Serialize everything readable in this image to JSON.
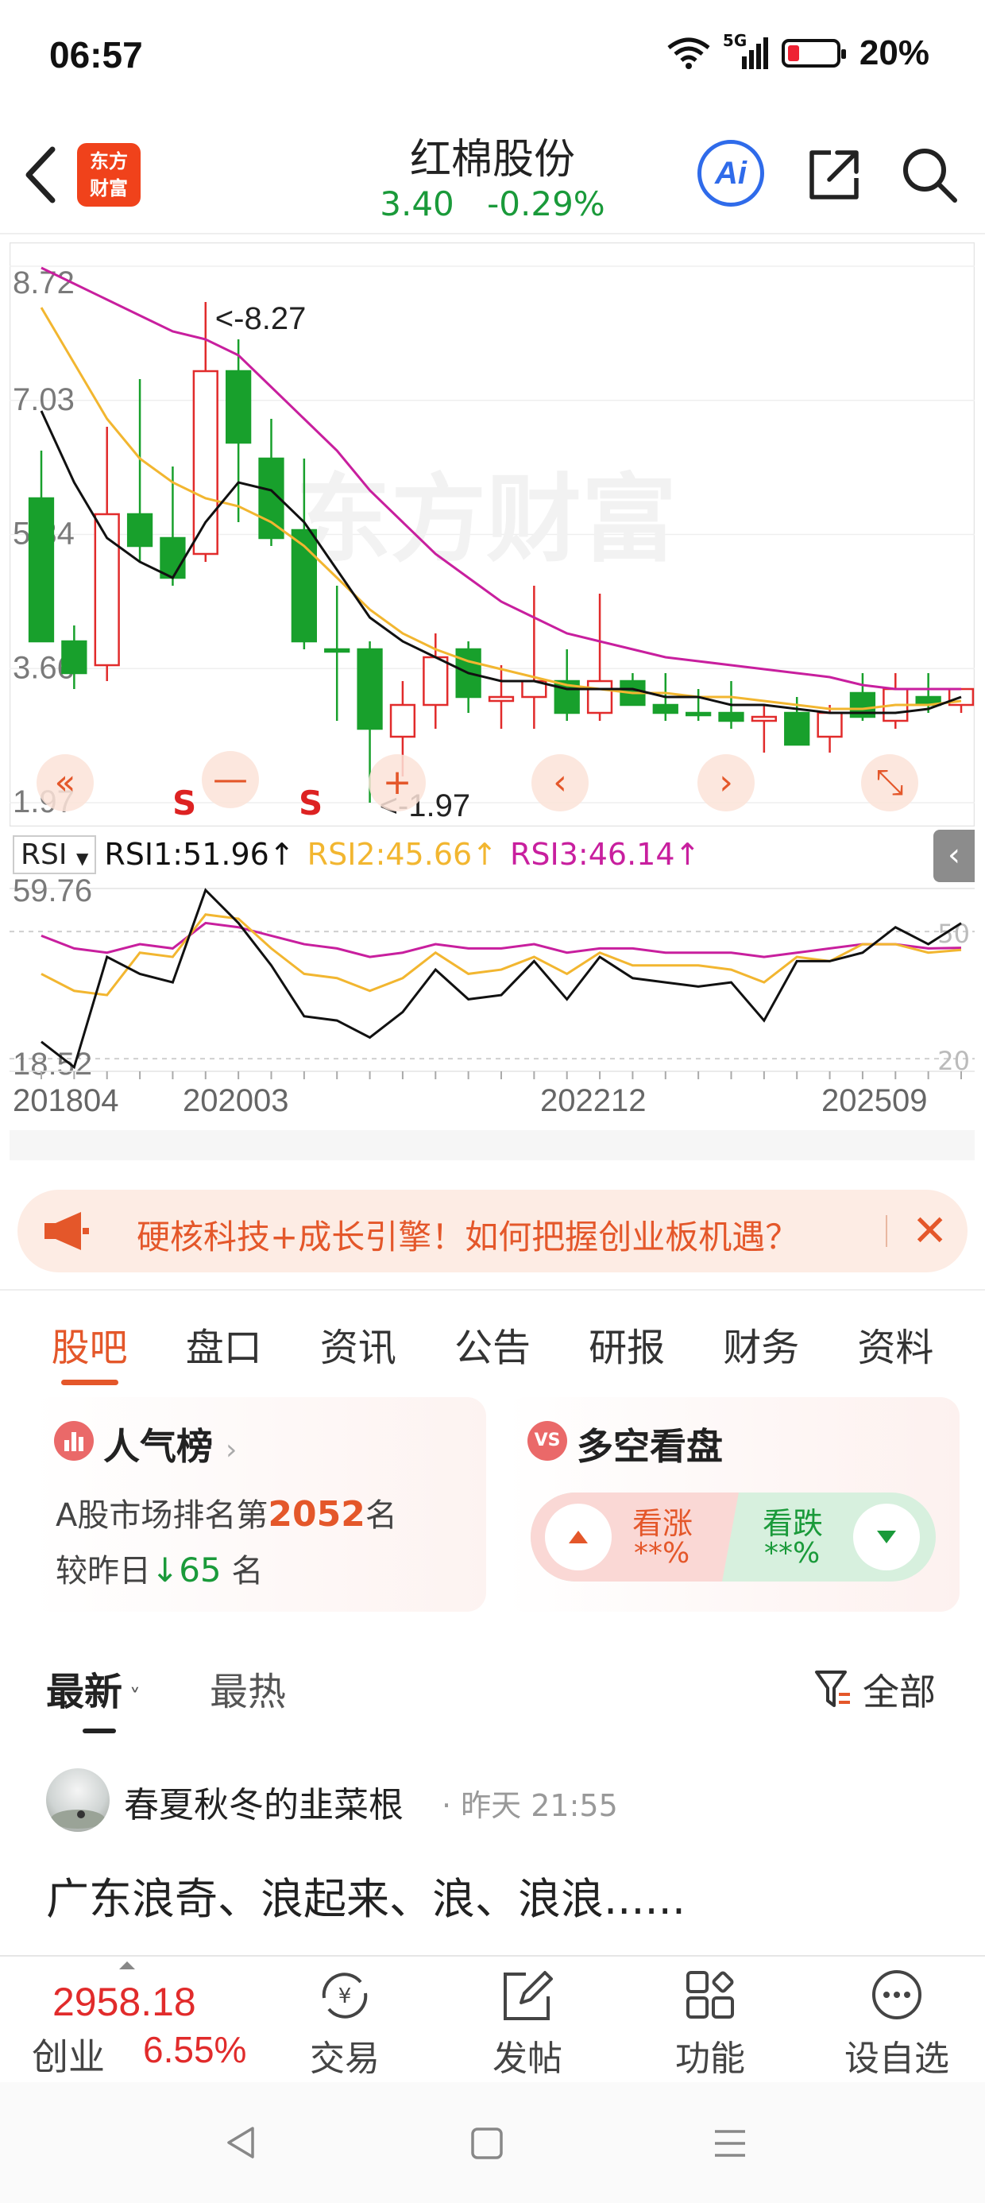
{
  "status_bar": {
    "time": "06:57",
    "network": "5G",
    "battery": "20%"
  },
  "header": {
    "back_icon": "chevron-left-icon",
    "logo_text_1": "东方",
    "logo_text_2": "财富",
    "stock_name": "红棉股份",
    "price": "3.40",
    "change_pct": "-0.29%",
    "ai_label": "Ai"
  },
  "chart": {
    "price_ticks": [
      "8.72",
      "7.03",
      "5.34",
      "3.66",
      "1.97"
    ],
    "high_marker": "<-8.27",
    "low_marker": "<-1.97",
    "signal_labels": [
      "S",
      "S"
    ],
    "watermark": "东方财富",
    "rsi_selector": "RSI",
    "rsi1": "RSI1:51.96↑",
    "rsi2": "RSI2:45.66↑",
    "rsi3": "RSI3:46.14↑",
    "rsi_ticks": [
      "59.76",
      "18.52"
    ],
    "rsi_ref_lines": [
      "50",
      "20"
    ],
    "date_labels": [
      "201804",
      "202003",
      "202212",
      "202509"
    ],
    "colors": {
      "up": "#e12b2b",
      "down": "#18a02c",
      "ma1": "#111111",
      "ma2": "#f2b630",
      "ma3": "#c81f9e"
    }
  },
  "chart_data": {
    "type": "candlestick",
    "title": "红棉股份",
    "candles": [
      {
        "o": 5.8,
        "h": 6.4,
        "l": 4.3,
        "c": 4.0,
        "up": false
      },
      {
        "o": 4.0,
        "h": 4.2,
        "l": 3.4,
        "c": 3.6,
        "up": false
      },
      {
        "o": 3.7,
        "h": 6.7,
        "l": 3.5,
        "c": 5.6,
        "up": true
      },
      {
        "o": 5.6,
        "h": 7.3,
        "l": 5.0,
        "c": 5.2,
        "up": false
      },
      {
        "o": 5.3,
        "h": 6.2,
        "l": 4.7,
        "c": 4.8,
        "up": false
      },
      {
        "o": 5.1,
        "h": 8.27,
        "l": 5.0,
        "c": 7.4,
        "up": true
      },
      {
        "o": 7.4,
        "h": 7.8,
        "l": 5.5,
        "c": 6.5,
        "up": false
      },
      {
        "o": 6.3,
        "h": 6.8,
        "l": 5.2,
        "c": 5.3,
        "up": false
      },
      {
        "o": 5.4,
        "h": 6.3,
        "l": 3.9,
        "c": 4.0,
        "up": false
      },
      {
        "o": 3.9,
        "h": 4.7,
        "l": 3.0,
        "c": 3.9,
        "up": false
      },
      {
        "o": 3.9,
        "h": 4.0,
        "l": 1.97,
        "c": 2.9,
        "up": false
      },
      {
        "o": 2.8,
        "h": 3.5,
        "l": 2.3,
        "c": 3.2,
        "up": true
      },
      {
        "o": 3.2,
        "h": 4.1,
        "l": 2.9,
        "c": 3.8,
        "up": true
      },
      {
        "o": 3.9,
        "h": 4.0,
        "l": 3.1,
        "c": 3.3,
        "up": false
      },
      {
        "o": 3.25,
        "h": 3.7,
        "l": 2.9,
        "c": 3.3,
        "up": true
      },
      {
        "o": 3.3,
        "h": 4.7,
        "l": 2.9,
        "c": 3.5,
        "up": true
      },
      {
        "o": 3.5,
        "h": 3.9,
        "l": 3.0,
        "c": 3.1,
        "up": false
      },
      {
        "o": 3.1,
        "h": 4.6,
        "l": 3.0,
        "c": 3.5,
        "up": true
      },
      {
        "o": 3.5,
        "h": 3.6,
        "l": 3.2,
        "c": 3.2,
        "up": false
      },
      {
        "o": 3.2,
        "h": 3.6,
        "l": 3.0,
        "c": 3.1,
        "up": false
      },
      {
        "o": 3.1,
        "h": 3.4,
        "l": 3.0,
        "c": 3.1,
        "up": false
      },
      {
        "o": 3.1,
        "h": 3.5,
        "l": 2.9,
        "c": 3.0,
        "up": false
      },
      {
        "o": 3.0,
        "h": 3.2,
        "l": 2.6,
        "c": 3.05,
        "up": true
      },
      {
        "o": 3.1,
        "h": 3.3,
        "l": 2.7,
        "c": 2.7,
        "up": false
      },
      {
        "o": 2.8,
        "h": 3.2,
        "l": 2.6,
        "c": 3.1,
        "up": true
      },
      {
        "o": 3.35,
        "h": 3.6,
        "l": 3.0,
        "c": 3.05,
        "up": false
      },
      {
        "o": 3.0,
        "h": 3.6,
        "l": 2.9,
        "c": 3.4,
        "up": true
      },
      {
        "o": 3.3,
        "h": 3.6,
        "l": 3.1,
        "c": 3.2,
        "up": false
      },
      {
        "o": 3.2,
        "h": 3.4,
        "l": 3.1,
        "c": 3.4,
        "up": true
      }
    ],
    "ma1": [
      6.9,
      6.0,
      5.3,
      5.0,
      4.8,
      5.5,
      6.0,
      5.9,
      5.5,
      4.9,
      4.3,
      4.0,
      3.8,
      3.6,
      3.5,
      3.5,
      3.4,
      3.4,
      3.4,
      3.3,
      3.3,
      3.2,
      3.2,
      3.15,
      3.1,
      3.1,
      3.1,
      3.15,
      3.3
    ],
    "ma2": [
      8.2,
      7.5,
      6.8,
      6.3,
      6.0,
      5.8,
      5.7,
      5.5,
      5.2,
      4.8,
      4.4,
      4.1,
      3.9,
      3.75,
      3.65,
      3.55,
      3.45,
      3.4,
      3.35,
      3.35,
      3.3,
      3.3,
      3.25,
      3.2,
      3.15,
      3.15,
      3.2,
      3.2,
      3.25
    ],
    "ma3": [
      8.7,
      8.5,
      8.3,
      8.1,
      7.9,
      7.8,
      7.6,
      7.2,
      6.8,
      6.4,
      5.9,
      5.5,
      5.1,
      4.8,
      4.5,
      4.3,
      4.1,
      4.0,
      3.9,
      3.8,
      3.75,
      3.7,
      3.65,
      3.6,
      3.55,
      3.45,
      3.4,
      3.4,
      3.4
    ],
    "rsi1": [
      24,
      18,
      44,
      40,
      38,
      59.76,
      52,
      42,
      30,
      29,
      25,
      31,
      41,
      34,
      35,
      43,
      34,
      44,
      39,
      38,
      37,
      38,
      29,
      43,
      43,
      45,
      51,
      47,
      51.96
    ],
    "rsi2": [
      40,
      36,
      35,
      45,
      44,
      54,
      53,
      46,
      40,
      39,
      36,
      39,
      45,
      40,
      41,
      44,
      40,
      45,
      42,
      42,
      42,
      41,
      38,
      44,
      43,
      47,
      47,
      45,
      45.66
    ],
    "rsi3": [
      49,
      46,
      45,
      47,
      46,
      52,
      51,
      49,
      47,
      46,
      44,
      45,
      47,
      46,
      46,
      47,
      45,
      46,
      46,
      45,
      45,
      45,
      44,
      45,
      46,
      47,
      47,
      46,
      46.14
    ],
    "ylim": [
      1.97,
      8.72
    ],
    "rsi_ylim": [
      18.52,
      59.76
    ]
  },
  "banner": {
    "icon": "megaphone-icon",
    "text": "硬核科技+成长引擎！如何把握创业板机遇？"
  },
  "tabs": [
    "股吧",
    "盘口",
    "资讯",
    "公告",
    "研报",
    "财务",
    "资料"
  ],
  "popularity": {
    "title": "人气榜",
    "rank_prefix": "A股市场排名第",
    "rank": "2052",
    "rank_suffix": "名",
    "change_prefix": "较昨日",
    "change_value": "65",
    "change_suffix": "名"
  },
  "sentiment": {
    "title": "多空看盘",
    "icon_text": "VS",
    "up_label": "看涨",
    "up_pct": "**%",
    "down_label": "看跌",
    "down_pct": "**%"
  },
  "feed": {
    "tab_latest": "最新",
    "tab_hot": "最热",
    "filter": "全部"
  },
  "post": {
    "username": "春夏秋冬的韭菜根",
    "meta": "· 昨天 21:55",
    "body": "广东浪奇、浪起来、浪、浪浪......"
  },
  "bottom_bar": {
    "index_value": "2958.18",
    "index_name": "创业",
    "index_change": "6.55%",
    "items": [
      "交易",
      "发帖",
      "功能",
      "设自选"
    ]
  }
}
